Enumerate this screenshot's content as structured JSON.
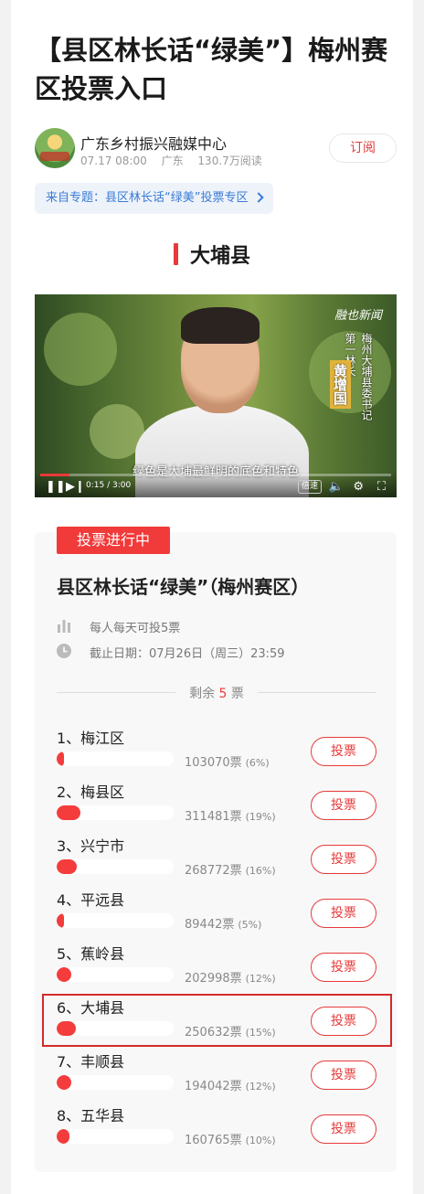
{
  "article": {
    "title": "【县区林长话“绿美”】梅州赛区投票入口",
    "author": "广东乡村振兴融媒中心",
    "date": "07.17 08:00",
    "location": "广东",
    "reads": "130.7万阅读",
    "subscribe_label": "订阅",
    "topic": "来自专题：县区林长话“绿美”投票专区"
  },
  "section": {
    "title": "大埔县"
  },
  "video": {
    "watermark": "融也新闻",
    "caption_title": "梅州大埔县委书记",
    "caption_role": "第一林长",
    "caption_name": "黄增国",
    "subtitle": "绿色是大埔最鲜明的底色和特色",
    "time": "0:15 / 3:00",
    "progress": 0.083,
    "speed_label": "倍速"
  },
  "vote": {
    "status": "投票进行中",
    "title": "县区林长话“绿美”（梅州赛区）",
    "rule": "每人每天可投5票",
    "deadline": "截止日期：07月26日（周三）23:59",
    "remaining_prefix": "剩余",
    "remaining": "5",
    "remaining_suffix": "票",
    "button_label": "投票",
    "accent": "#e83a3a",
    "items": [
      {
        "name": "1、梅江区",
        "votes": "103070票",
        "pct": "(6%)",
        "share": 0.06
      },
      {
        "name": "2、梅县区",
        "votes": "311481票",
        "pct": "(19%)",
        "share": 0.19
      },
      {
        "name": "3、兴宁市",
        "votes": "268772票",
        "pct": "(16%)",
        "share": 0.16
      },
      {
        "name": "4、平远县",
        "votes": "89442票",
        "pct": "(5%)",
        "share": 0.05
      },
      {
        "name": "5、蕉岭县",
        "votes": "202998票",
        "pct": "(12%)",
        "share": 0.12
      },
      {
        "name": "6、大埔县",
        "votes": "250632票",
        "pct": "(15%)",
        "share": 0.15
      },
      {
        "name": "7、丰顺县",
        "votes": "194042票",
        "pct": "(12%)",
        "share": 0.12
      },
      {
        "name": "8、五华县",
        "votes": "160765票",
        "pct": "(10%)",
        "share": 0.1
      }
    ]
  }
}
